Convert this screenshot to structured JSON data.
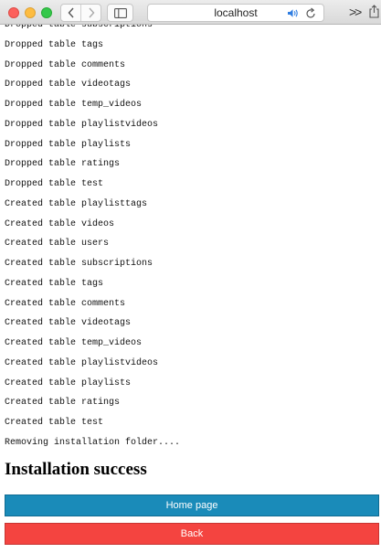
{
  "browser": {
    "address": "localhost"
  },
  "log_lines": [
    "Dropped table subscriptions",
    "Dropped table tags",
    "Dropped table comments",
    "Dropped table videotags",
    "Dropped table temp_videos",
    "Dropped table playlistvideos",
    "Dropped table playlists",
    "Dropped table ratings",
    "Dropped table test",
    "Created table playlisttags",
    "Created table videos",
    "Created table users",
    "Created table subscriptions",
    "Created table tags",
    "Created table comments",
    "Created table videotags",
    "Created table temp_videos",
    "Created table playlistvideos",
    "Created table playlists",
    "Created table ratings",
    "Created table test",
    "Removing installation folder...."
  ],
  "heading": "Installation success",
  "buttons": {
    "home": "Home page",
    "back": "Back"
  },
  "colors": {
    "home_button": "#1a8bb9",
    "back_button": "#f44440"
  }
}
